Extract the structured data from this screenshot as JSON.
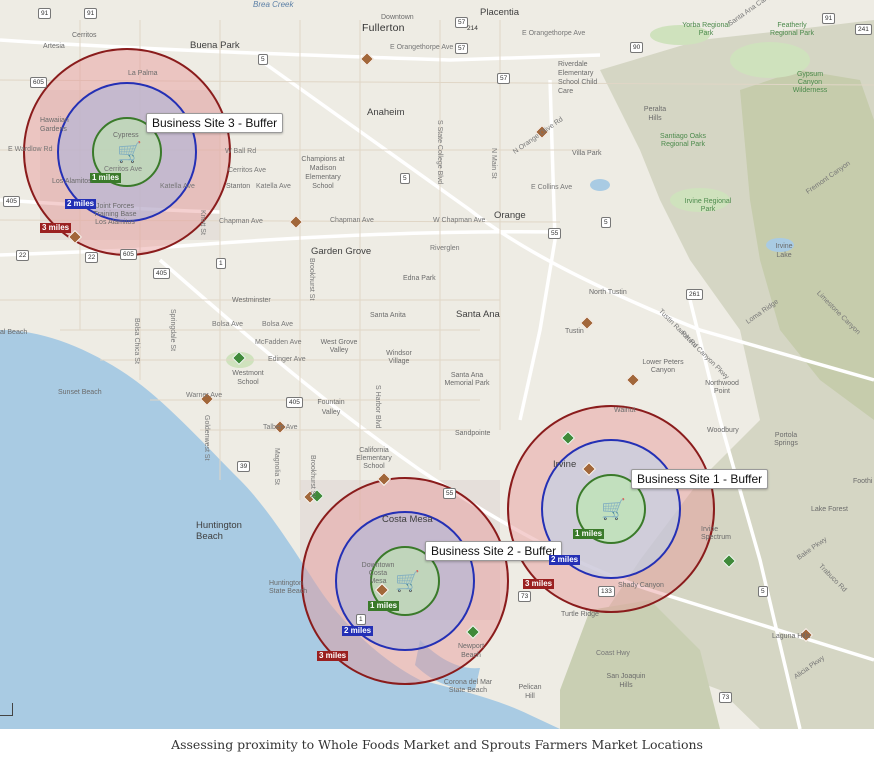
{
  "map": {
    "colors": {
      "land": "#eeece4",
      "water": "#a9cbe3",
      "hills": "#c9cfb3",
      "park": "#cfe2bd",
      "urban": "#e6e1dc",
      "major_road": "#ffffff",
      "whole_foods": "#3f8a3a",
      "sprouts": "#a2673a",
      "ring_1_mile": "#3a7a2a",
      "ring_2_miles": "#2430b5",
      "ring_3_miles": "#8a1c1c"
    },
    "callouts": {
      "site1": "Business Site 1 - Buffer",
      "site2": "Business Site 2 - Buffer",
      "site3": "Business Site 3 - Buffer"
    },
    "ring_labels": {
      "one": "1 miles",
      "two": "2 miles",
      "three": "3 miles"
    },
    "store_icon": "shopping-cart-icon",
    "places": {
      "fullerton": "Fullerton",
      "downtown": "Downtown",
      "placentia": "Placentia",
      "buena_park": "Buena Park",
      "cerritos": "Cerritos",
      "artesia": "Artesia",
      "la_palma": "La Palma",
      "hawaiian_gardens": "Hawaiian Gardens",
      "cypress": "Cypress",
      "los_alamitos": "Los Alamitos",
      "stanton": "Stanton",
      "anaheim": "Anaheim",
      "champions": "Champions at Madison Elementary School",
      "riverdale": "Riverdale Elementary School Child Care",
      "villa_park": "Villa Park",
      "orange": "Orange",
      "garden_grove": "Garden Grove",
      "westminster": "Westminster",
      "santa_ana": "Santa Ana",
      "north_tustin": "North Tustin",
      "tustin": "Tustin",
      "seal_beach": "al Beach",
      "sunset_beach": "Sunset Beach",
      "westmont_school": "Westmont School",
      "fountain_valley": "Fountain Valley",
      "west_grove_valley": "West Grove Valley",
      "windsor_village": "Windsor Village",
      "santa_ana_park": "Santa Ana Memorial Park",
      "sandpointe": "Sandpointe",
      "california_school": "California Elementary School",
      "huntington_beach": "Huntington Beach",
      "huntington_state_beach": "Huntington State Beach",
      "costa_mesa": "Costa Mesa",
      "downtown_costa_mesa": "Downtown Costa Mesa",
      "newport_beach": "Newport Beach",
      "corona_del_mar": "Corona del Mar State Beach",
      "irvine": "Irvine",
      "woodbury": "Woodbury",
      "lake_forest": "Lake Forest",
      "laguna_hills": "Laguna Hills",
      "portola_springs": "Portola Springs",
      "northwood_point": "Northwood Point",
      "lower_peters_canyon": "Lower Peters Canyon",
      "peralta_hills": "Peralta Hills",
      "pelican_hill": "Pelican Hill",
      "san_joaquin_hills": "San Joaquin Hills",
      "irvine_lake": "Irvine Lake",
      "edna_park": "Edna Park",
      "santa_anita": "Santa Anita",
      "irvine_spectrum": "Irvine Spectrum",
      "shady_canyon": "Shady Canyon",
      "joint_forces": "Joint Forces Training Base Los Alamitos",
      "yorba_park": "Yorba Regional Park",
      "featherly_park": "Featherly Regional Park",
      "gypsum_canyon": "Gypsum Canyon Wilderness",
      "santiago_oaks": "Santiago Oaks Regional Park",
      "irvine_park": "Irvine Regional Park",
      "foothill": "Foothi",
      "brea_creek": "Brea Creek",
      "turtle_ridge": "Turtle Ridge",
      "walnut": "Walnut"
    },
    "streets": {
      "e_orangethorpe_1": "E Orangethorpe Ave",
      "e_orangethorpe_2": "E Orangethorpe Ave",
      "w_ball": "W Ball Rd",
      "cerritos_ave_1": "Cerritos Ave",
      "cerritos_ave_2": "Cerritos Ave",
      "katella_1": "Katella Ave",
      "katella_2": "Katella Ave",
      "chapman_1": "Chapman Ave",
      "chapman_2": "Chapman Ave",
      "chapman_3": "W Chapman Ave",
      "e_collins": "E Collins Ave",
      "riverglen": "Riverglen",
      "bolsa_1": "Bolsa Ave",
      "bolsa_2": "Bolsa Ave",
      "mcfadden": "McFadden Ave",
      "edinger": "Edinger Ave",
      "warner": "Warner Ave",
      "talbert": "Talbert Ave",
      "e_wardlow": "E Wardlow Rd",
      "s_state_college": "S State College Blvd",
      "n_main": "N Main St",
      "brookhurst_1": "Brookhurst St",
      "brookhurst_2": "Brookhurst St",
      "bolsa_chica": "Bolsa Chica St",
      "springdale": "Springdale St",
      "goldenwest": "Goldenwest St",
      "magnolia": "Magnolia St",
      "s_harbor": "S Harbor Blvd",
      "knott": "Knott St",
      "n_orange_olive": "N Orange Olive Rd",
      "lomaridge": "Loma Ridge",
      "peters_canyon": "Peters Canyon Pkwy",
      "bake_pkwy": "Bake Pkwy",
      "trabuco": "Trabuco Rd",
      "alicia": "Alicia Pkwy",
      "coast_hwy": "Coast Hwy",
      "tustin_ranch": "Tustin Ranch Rd",
      "fremont": "Fremont Canyon",
      "santa_ana_canyon": "Santa Ana Canyon",
      "limestone": "Limestone Canyon"
    },
    "shields": [
      "91",
      "91",
      "57",
      "57",
      "57",
      "214",
      "90",
      "5",
      "605",
      "405",
      "22",
      "22",
      "605",
      "405",
      "5",
      "55",
      "261",
      "133",
      "73",
      "73",
      "5",
      "405",
      "55",
      "39",
      "1",
      "1",
      "91",
      "241",
      "5"
    ]
  },
  "caption": "Assessing proximity to Whole Foods Market and Sprouts Farmers Market Locations"
}
